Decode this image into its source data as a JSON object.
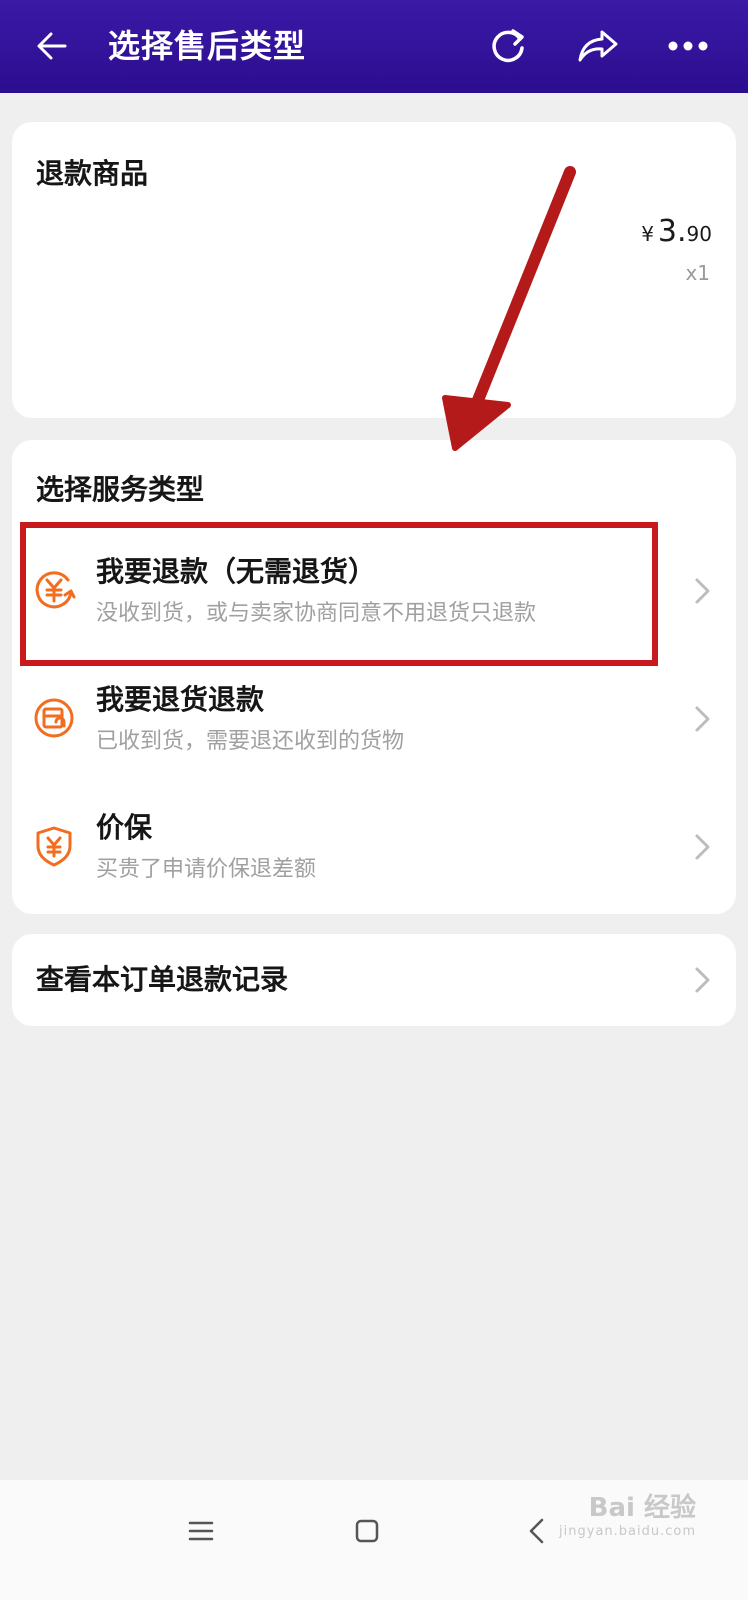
{
  "header": {
    "title": "选择售后类型",
    "icons": [
      "back-arrow-icon",
      "refresh-icon",
      "share-icon",
      "more-icon"
    ],
    "background_color": "#2f1199"
  },
  "product_card": {
    "title": "退款商品",
    "price_symbol": "¥",
    "price_integer": "3.",
    "price_decimal": "90",
    "quantity": "x1"
  },
  "service_card": {
    "title": "选择服务类型",
    "options": [
      {
        "title": "我要退款（无需退货）",
        "description": "没收到货，或与卖家协商同意不用退货只退款",
        "icon": "yuan-refund-icon"
      },
      {
        "title": "我要退货退款",
        "description": "已收到货，需要退还收到的货物",
        "icon": "return-goods-icon"
      },
      {
        "title": "价保",
        "description": "买贵了申请价保退差额",
        "icon": "price-protection-shield-icon"
      }
    ]
  },
  "records": {
    "label": "查看本订单退款记录"
  },
  "annotations": {
    "highlight_color": "#c8191c",
    "arrow_color": "#b51a1a"
  },
  "watermark": {
    "text": "Bai 经验",
    "sub": "jingyan.baidu.com"
  },
  "accent_color": "#f36d21"
}
